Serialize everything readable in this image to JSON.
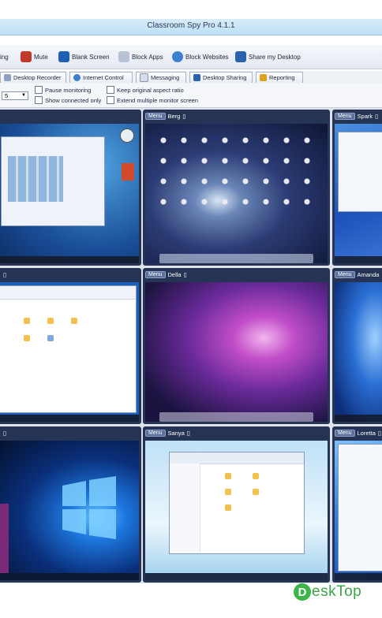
{
  "window": {
    "title": "Classroom Spy Pro 4.1.1"
  },
  "toolbar": {
    "items": [
      {
        "label": "ing",
        "icon": "chat-icon"
      },
      {
        "label": "Mute",
        "icon": "mute-icon"
      },
      {
        "label": "Blank Screen",
        "icon": "monitor-icon"
      },
      {
        "label": "Block Apps",
        "icon": "block-apps-icon"
      },
      {
        "label": "Block Websites",
        "icon": "globe-block-icon"
      },
      {
        "label": "Share my Desktop",
        "icon": "share-desktop-icon"
      }
    ]
  },
  "tabs": [
    {
      "label": "Desktop Recorder",
      "icon": "recorder-icon"
    },
    {
      "label": "Internet Control",
      "icon": "internet-icon"
    },
    {
      "label": "Messaging",
      "icon": "messaging-icon"
    },
    {
      "label": "Desktop Sharing",
      "icon": "sharing-icon"
    },
    {
      "label": "Reporting",
      "icon": "reporting-icon"
    }
  ],
  "options": {
    "select_value": "5",
    "checkboxes": [
      {
        "label": "Pause monitoring",
        "checked": false
      },
      {
        "label": "Show connected only",
        "checked": false
      },
      {
        "label": "Keep original aspect ratio",
        "checked": false
      },
      {
        "label": "Extend multiple monitor screen",
        "checked": false
      }
    ]
  },
  "panels": [
    {
      "menu": "",
      "name": "",
      "os": "win7"
    },
    {
      "menu": "Menu",
      "name": "Berg",
      "os": "mac"
    },
    {
      "menu": "Menu",
      "name": "Spark",
      "os": "win8"
    },
    {
      "menu": "",
      "name": "",
      "os": "win10explorer"
    },
    {
      "menu": "Menu",
      "name": "Della",
      "os": "macpurple"
    },
    {
      "menu": "Menu",
      "name": "Amanda",
      "os": "win7blue"
    },
    {
      "menu": "",
      "name": "",
      "os": "win10hero"
    },
    {
      "menu": "Menu",
      "name": "Sanya",
      "os": "win10light"
    },
    {
      "menu": "Menu",
      "name": "Loretta",
      "os": "win10blue"
    }
  ],
  "watermark": {
    "letter": "D",
    "text": "eskTop"
  },
  "colors": {
    "panel_header": "#253455",
    "title_bar": "#c8e4f8",
    "accent_green": "#3bb44a"
  }
}
